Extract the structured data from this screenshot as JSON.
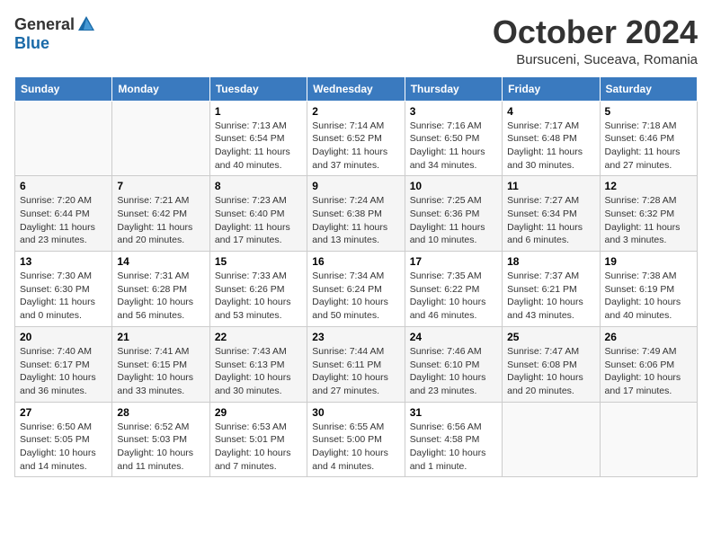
{
  "header": {
    "logo_general": "General",
    "logo_blue": "Blue",
    "month_title": "October 2024",
    "location": "Bursuceni, Suceava, Romania"
  },
  "days_of_week": [
    "Sunday",
    "Monday",
    "Tuesday",
    "Wednesday",
    "Thursday",
    "Friday",
    "Saturday"
  ],
  "weeks": [
    [
      {
        "day": "",
        "content": ""
      },
      {
        "day": "",
        "content": ""
      },
      {
        "day": "1",
        "content": "Sunrise: 7:13 AM\nSunset: 6:54 PM\nDaylight: 11 hours and 40 minutes."
      },
      {
        "day": "2",
        "content": "Sunrise: 7:14 AM\nSunset: 6:52 PM\nDaylight: 11 hours and 37 minutes."
      },
      {
        "day": "3",
        "content": "Sunrise: 7:16 AM\nSunset: 6:50 PM\nDaylight: 11 hours and 34 minutes."
      },
      {
        "day": "4",
        "content": "Sunrise: 7:17 AM\nSunset: 6:48 PM\nDaylight: 11 hours and 30 minutes."
      },
      {
        "day": "5",
        "content": "Sunrise: 7:18 AM\nSunset: 6:46 PM\nDaylight: 11 hours and 27 minutes."
      }
    ],
    [
      {
        "day": "6",
        "content": "Sunrise: 7:20 AM\nSunset: 6:44 PM\nDaylight: 11 hours and 23 minutes."
      },
      {
        "day": "7",
        "content": "Sunrise: 7:21 AM\nSunset: 6:42 PM\nDaylight: 11 hours and 20 minutes."
      },
      {
        "day": "8",
        "content": "Sunrise: 7:23 AM\nSunset: 6:40 PM\nDaylight: 11 hours and 17 minutes."
      },
      {
        "day": "9",
        "content": "Sunrise: 7:24 AM\nSunset: 6:38 PM\nDaylight: 11 hours and 13 minutes."
      },
      {
        "day": "10",
        "content": "Sunrise: 7:25 AM\nSunset: 6:36 PM\nDaylight: 11 hours and 10 minutes."
      },
      {
        "day": "11",
        "content": "Sunrise: 7:27 AM\nSunset: 6:34 PM\nDaylight: 11 hours and 6 minutes."
      },
      {
        "day": "12",
        "content": "Sunrise: 7:28 AM\nSunset: 6:32 PM\nDaylight: 11 hours and 3 minutes."
      }
    ],
    [
      {
        "day": "13",
        "content": "Sunrise: 7:30 AM\nSunset: 6:30 PM\nDaylight: 11 hours and 0 minutes."
      },
      {
        "day": "14",
        "content": "Sunrise: 7:31 AM\nSunset: 6:28 PM\nDaylight: 10 hours and 56 minutes."
      },
      {
        "day": "15",
        "content": "Sunrise: 7:33 AM\nSunset: 6:26 PM\nDaylight: 10 hours and 53 minutes."
      },
      {
        "day": "16",
        "content": "Sunrise: 7:34 AM\nSunset: 6:24 PM\nDaylight: 10 hours and 50 minutes."
      },
      {
        "day": "17",
        "content": "Sunrise: 7:35 AM\nSunset: 6:22 PM\nDaylight: 10 hours and 46 minutes."
      },
      {
        "day": "18",
        "content": "Sunrise: 7:37 AM\nSunset: 6:21 PM\nDaylight: 10 hours and 43 minutes."
      },
      {
        "day": "19",
        "content": "Sunrise: 7:38 AM\nSunset: 6:19 PM\nDaylight: 10 hours and 40 minutes."
      }
    ],
    [
      {
        "day": "20",
        "content": "Sunrise: 7:40 AM\nSunset: 6:17 PM\nDaylight: 10 hours and 36 minutes."
      },
      {
        "day": "21",
        "content": "Sunrise: 7:41 AM\nSunset: 6:15 PM\nDaylight: 10 hours and 33 minutes."
      },
      {
        "day": "22",
        "content": "Sunrise: 7:43 AM\nSunset: 6:13 PM\nDaylight: 10 hours and 30 minutes."
      },
      {
        "day": "23",
        "content": "Sunrise: 7:44 AM\nSunset: 6:11 PM\nDaylight: 10 hours and 27 minutes."
      },
      {
        "day": "24",
        "content": "Sunrise: 7:46 AM\nSunset: 6:10 PM\nDaylight: 10 hours and 23 minutes."
      },
      {
        "day": "25",
        "content": "Sunrise: 7:47 AM\nSunset: 6:08 PM\nDaylight: 10 hours and 20 minutes."
      },
      {
        "day": "26",
        "content": "Sunrise: 7:49 AM\nSunset: 6:06 PM\nDaylight: 10 hours and 17 minutes."
      }
    ],
    [
      {
        "day": "27",
        "content": "Sunrise: 6:50 AM\nSunset: 5:05 PM\nDaylight: 10 hours and 14 minutes."
      },
      {
        "day": "28",
        "content": "Sunrise: 6:52 AM\nSunset: 5:03 PM\nDaylight: 10 hours and 11 minutes."
      },
      {
        "day": "29",
        "content": "Sunrise: 6:53 AM\nSunset: 5:01 PM\nDaylight: 10 hours and 7 minutes."
      },
      {
        "day": "30",
        "content": "Sunrise: 6:55 AM\nSunset: 5:00 PM\nDaylight: 10 hours and 4 minutes."
      },
      {
        "day": "31",
        "content": "Sunrise: 6:56 AM\nSunset: 4:58 PM\nDaylight: 10 hours and 1 minute."
      },
      {
        "day": "",
        "content": ""
      },
      {
        "day": "",
        "content": ""
      }
    ]
  ]
}
